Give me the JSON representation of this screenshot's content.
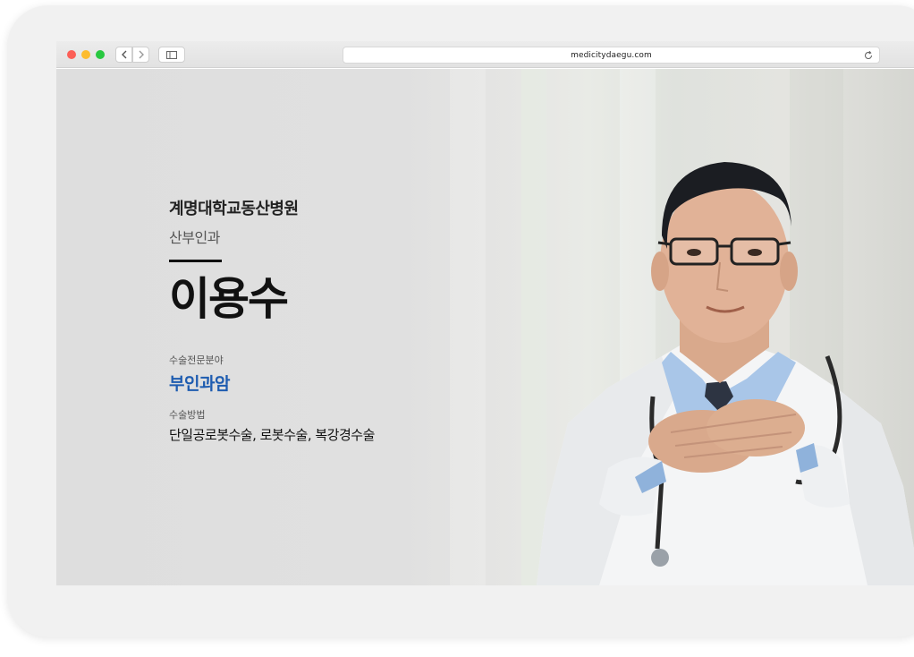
{
  "browser": {
    "url": "medicitydaegu.com"
  },
  "doctor_profile": {
    "hospital": "계명대학교동산병원",
    "department": "산부인과",
    "name": "이용수",
    "specialty_label": "수술전문분야",
    "specialty_value": "부인과암",
    "method_label": "수술방법",
    "method_value": "단일공로봇수술, 로봇수술, 복강경수술"
  },
  "colors": {
    "accent": "#1e5cb0",
    "text": "#111111",
    "muted": "#555555"
  }
}
